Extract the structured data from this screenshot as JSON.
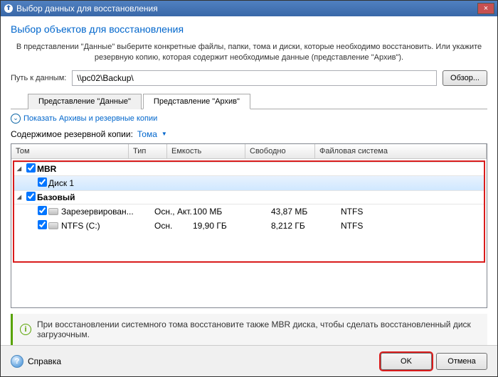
{
  "window": {
    "title": "Выбор данных для восстановления",
    "close_glyph": "×"
  },
  "header": {
    "title": "Выбор объектов для восстановления"
  },
  "instruction": "В представлении \"Данные\" выберите конкретные файлы, папки, тома и диски, которые необходимо восстановить. Или укажите резервную копию, которая содержит необходимые данные (представление \"Архив\").",
  "path": {
    "label": "Путь к данным:",
    "value": "\\\\pc02\\Backup\\",
    "browse": "Обзор..."
  },
  "tabs": {
    "data": "Представление \"Данные\"",
    "archive": "Представление \"Архив\""
  },
  "link": {
    "expand_glyph": "⌄",
    "text": "Показать Архивы и резервные копии"
  },
  "sub": {
    "label": "Содержимое резервной копии:",
    "value": "Тома",
    "arrow": "▼"
  },
  "grid": {
    "headers": {
      "tom": "Том",
      "tip": "Тип",
      "em": "Емкость",
      "sv": "Свободно",
      "fs": "Файловая система"
    },
    "mbr": {
      "name": "MBR",
      "arrow": "◢"
    },
    "disk1": {
      "name": "Диск 1"
    },
    "basic": {
      "name": "Базовый",
      "arrow": "◢"
    },
    "r1": {
      "name": "Зарезервирован...",
      "tip": "Осн., Акт.",
      "em": "100 МБ",
      "sv": "43,87 МБ",
      "fs": "NTFS"
    },
    "r2": {
      "name": "NTFS (C:)",
      "tip": "Осн.",
      "em": "19,90 ГБ",
      "sv": "8,212 ГБ",
      "fs": "NTFS"
    }
  },
  "info": {
    "glyph": "i",
    "text": "При восстановлении системного тома восстановите также MBR диска, чтобы сделать восстановленный диск загрузочным."
  },
  "bottom": {
    "help": "Справка",
    "help_glyph": "?",
    "ok": "OK",
    "cancel": "Отмена"
  }
}
